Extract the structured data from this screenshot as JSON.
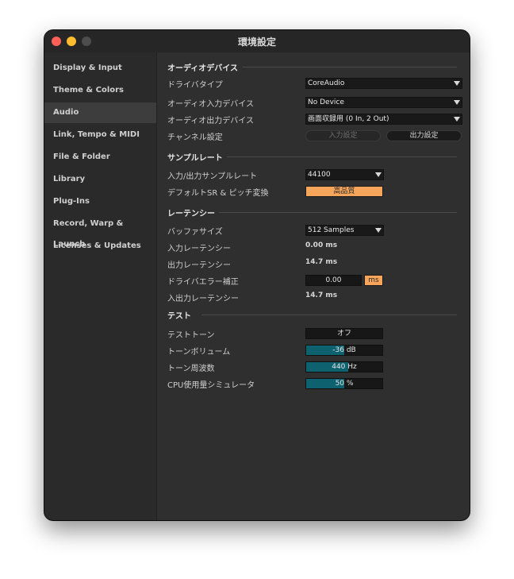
{
  "window": {
    "title": "環境設定"
  },
  "colors": {
    "accent_orange": "#f7a55a",
    "bar_teal": "#0e6270"
  },
  "sidebar": {
    "items": [
      {
        "label": "Display & Input"
      },
      {
        "label": "Theme & Colors"
      },
      {
        "label": "Audio",
        "active": true
      },
      {
        "label": "Link, Tempo & MIDI"
      },
      {
        "label": "File & Folder"
      },
      {
        "label": "Library"
      },
      {
        "label": "Plug-Ins"
      },
      {
        "label": "Record, Warp & Launch"
      },
      {
        "label": "Licenses & Updates"
      }
    ]
  },
  "audio_device": {
    "heading": "オーディオデバイス",
    "driver_type_label": "ドライバタイプ",
    "driver_type_value": "CoreAudio",
    "input_device_label": "オーディオ入力デバイス",
    "input_device_value": "No Device",
    "output_device_label": "オーディオ出力デバイス",
    "output_device_value": "画面収録用 (0 In, 2 Out)",
    "channel_label": "チャンネル設定",
    "input_config_button": "入力設定",
    "output_config_button": "出力設定"
  },
  "sample_rate": {
    "heading": "サンプルレート",
    "io_rate_label": "入力/出力サンプルレート",
    "io_rate_value": "44100",
    "default_sr_label": "デフォルトSR & ピッチ変換",
    "default_sr_value": "高品質"
  },
  "latency": {
    "heading": "レーテンシー",
    "buffer_label": "バッファサイズ",
    "buffer_value": "512 Samples",
    "input_latency_label": "入力レーテンシー",
    "input_latency_value": "0.00 ms",
    "output_latency_label": "出力レーテンシー",
    "output_latency_value": "14.7 ms",
    "driver_error_label": "ドライバエラー補正",
    "driver_error_value": "0.00",
    "driver_error_unit": "ms",
    "io_latency_label": "入出力レーテンシー",
    "io_latency_value": "14.7 ms"
  },
  "test": {
    "heading": "テスト",
    "tone_label": "テストトーン",
    "tone_value": "オフ",
    "volume_label": "トーンボリューム",
    "volume_value": "-36 dB",
    "volume_level": 0.5,
    "freq_label": "トーン周波数",
    "freq_value": "440 Hz",
    "freq_level": 0.55,
    "cpu_label": "CPU使用量シミュレータ",
    "cpu_value": "50 %",
    "cpu_level": 0.5
  }
}
